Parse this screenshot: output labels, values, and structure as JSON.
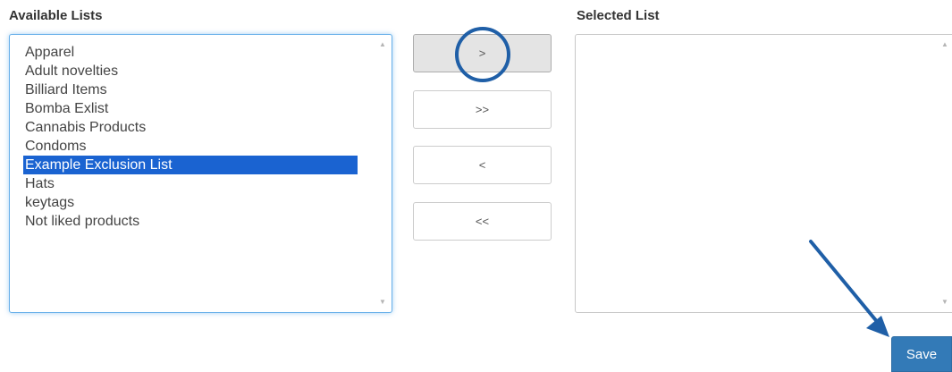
{
  "available_lists": {
    "heading": "Available Lists",
    "items": [
      "Apparel",
      "Adult novelties",
      "Billiard Items",
      "Bomba Exlist",
      "Cannabis Products",
      "Condoms",
      "Example Exclusion List",
      "Hats",
      "keytags",
      "Not liked products"
    ],
    "selected_item": "Example Exclusion List"
  },
  "selected_list": {
    "heading": "Selected List",
    "items": []
  },
  "transfer_buttons": {
    "move_selected_right": ">",
    "move_all_right": ">>",
    "move_selected_left": "<",
    "move_all_left": "<<"
  },
  "save_button": {
    "label": "Save"
  },
  "colors": {
    "selection_background": "#1a63d1",
    "primary_button": "#337ab7",
    "annotation": "#1f5fa7",
    "focus_border": "#66afe9"
  },
  "icons": {
    "scroll_up": "scroll-up-icon",
    "scroll_down": "scroll-down-icon",
    "annotation_circle": "highlight-circle",
    "annotation_arrow": "arrow-annotation"
  }
}
